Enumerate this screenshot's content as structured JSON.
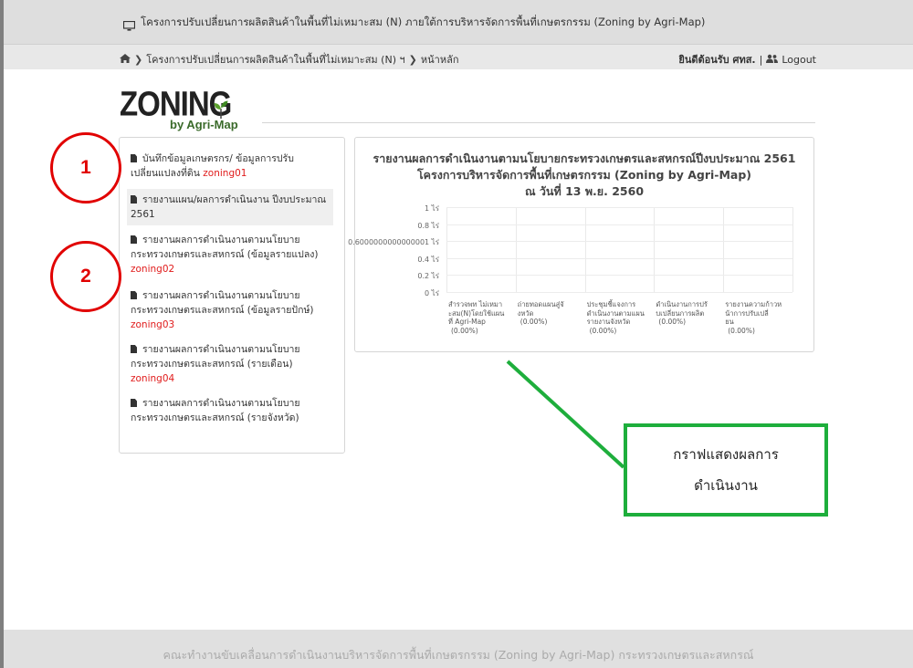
{
  "header": {
    "title": "โครงการปรับเปลี่ยนการผลิตสินค้าในพื้นที่ไม่เหมาะสม (N) ภายใต้การบริหารจัดการพื้นที่เกษตรกรรม (Zoning by Agri-Map)",
    "title_icon": "monitor-icon"
  },
  "breadcrumb": {
    "home_icon": "home-icon",
    "items": [
      "โครงการปรับเปลี่ยนการผลิตสินค้าในพื้นที่ไม่เหมาะสม (N) ฯ",
      "หน้าหลัก"
    ]
  },
  "user": {
    "welcome": "ยินดีต้อนรับ ศทส.",
    "divider": "|",
    "logout_label": "Logout",
    "logout_icon": "users-icon"
  },
  "logo": {
    "main": "ZONING",
    "sub": "by Agri-Map"
  },
  "sidebar": {
    "items": [
      {
        "label": "บันทึกข้อมูลเกษตรกร/ ข้อมูลการปรับเปลี่ยนแปลงที่ดิน",
        "code": "zoning01",
        "icon": "document-icon"
      },
      {
        "label": "รายงานแผน/ผลการดำเนินงาน ปีงบประมาณ 2561",
        "code": "",
        "icon": "document-icon"
      },
      {
        "label": "รายงานผลการดำเนินงานตามนโยบายกระทรวงเกษตรและสหกรณ์ (ข้อมูลรายแปลง)",
        "code": "zoning02",
        "icon": "document-icon"
      },
      {
        "label": "รายงานผลการดำเนินงานตามนโยบายกระทรวงเกษตรและสหกรณ์ (ข้อมูลรายปักษ์)",
        "code": "zoning03",
        "icon": "document-icon"
      },
      {
        "label": "รายงานผลการดำเนินงานตามนโยบายกระทรวงเกษตรและสหกรณ์ (รายเดือน)",
        "code": "zoning04",
        "icon": "document-icon"
      },
      {
        "label": "รายงานผลการดำเนินงานตามนโยบายกระทรวงเกษตรและสหกรณ์ (รายจังหวัด)",
        "code": "",
        "icon": "document-icon"
      }
    ]
  },
  "chart_data": {
    "type": "bar",
    "title_lines": [
      "รายงานผลการดำเนินงานตามนโยบายกระทรวงเกษตรและสหกรณ์ปีงบประมาณ 2561",
      "โครงการบริหารจัดการพื้นที่เกษตรกรรม (Zoning by Agri-Map)",
      "ณ วันที่ 13 พ.ย. 2560"
    ],
    "y_ticks": [
      "1 ไร่",
      "0.8 ไร่",
      "0.6000000000000001 ไร่",
      "0.4 ไร่",
      "0.2 ไร่",
      "0 ไร่"
    ],
    "ylim": [
      0,
      1
    ],
    "categories": [
      [
        "สำรวจพท ไม่เหมา",
        "ะสม(N)โดยใช้แผน",
        "ที่ Agri-Map",
        "(0.00%)"
      ],
      [
        "ถ่ายทอดแผนสู่จั",
        "งหวัด",
        "(0.00%)"
      ],
      [
        "ประชุมชี้แจงการ",
        "ดำเนินงานตามแผน",
        "รายงานจังหวัด",
        "(0.00%)"
      ],
      [
        "ดำเนินงานการปรั",
        "บเปลี่ยนการผลิต",
        "(0.00%)"
      ],
      [
        "รายงานความก้าวห",
        "น้าการปรับเปลี่",
        "ยน",
        "(0.00%)"
      ]
    ],
    "values": [
      0,
      0,
      0,
      0,
      0
    ]
  },
  "annotations": {
    "circle1": "1",
    "circle2": "2",
    "callout_line1": "กราฟแสดงผลการ",
    "callout_line2": "ดำเนินงาน",
    "callout_color": "#1eae3c",
    "circle_color": "#e10000"
  },
  "footer": {
    "text": "คณะทำงานขับเคลื่อนการดำเนินงานบริหารจัดการพื้นที่เกษตรกรรม (Zoning by Agri-Map) กระทรวงเกษตรและสหกรณ์"
  }
}
